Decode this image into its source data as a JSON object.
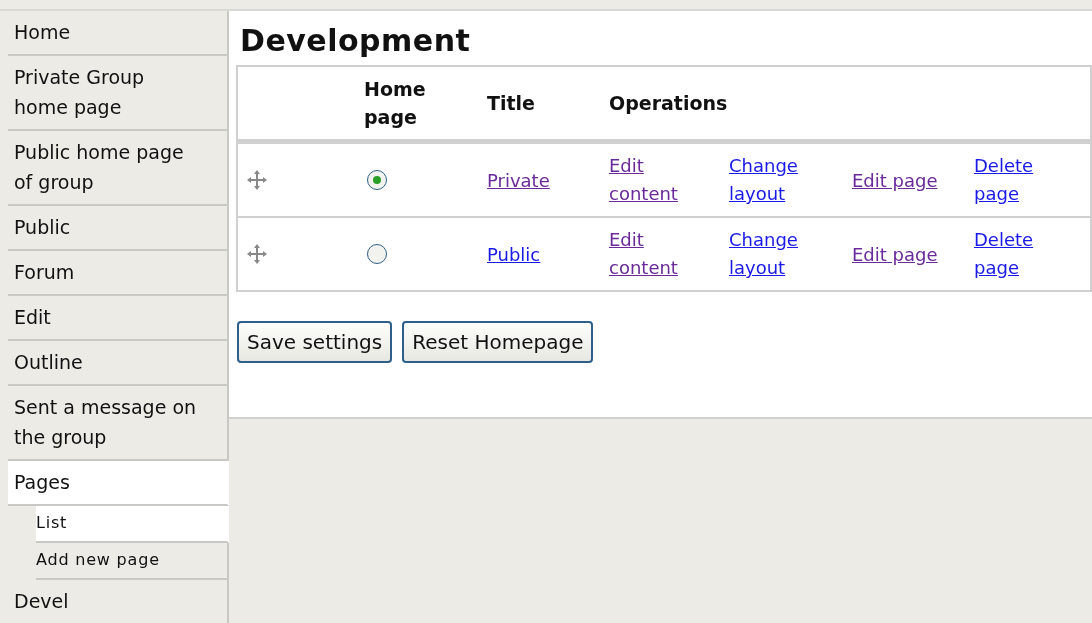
{
  "sidebar": {
    "items": [
      {
        "label": "Home",
        "selected": false
      },
      {
        "label": "Private Group home page",
        "selected": false
      },
      {
        "label": "Public home page of group",
        "selected": false
      },
      {
        "label": "Public",
        "selected": false
      },
      {
        "label": "Forum",
        "selected": false
      },
      {
        "label": "Edit",
        "selected": false
      },
      {
        "label": "Outline",
        "selected": false
      },
      {
        "label": "Sent a message on the group",
        "selected": false
      },
      {
        "label": "Pages",
        "selected": true,
        "children": [
          {
            "label": "List",
            "selected": true
          },
          {
            "label": "Add new page",
            "selected": false
          }
        ]
      },
      {
        "label": "Devel",
        "selected": false
      }
    ]
  },
  "page_title": "Development",
  "table": {
    "columns": [
      "",
      "Home page",
      "Title",
      "Operations"
    ],
    "rows": [
      {
        "home_page": true,
        "title": {
          "label": "Private",
          "visited": true
        },
        "operations": [
          {
            "label": "Edit content",
            "visited": true
          },
          {
            "label": "Change layout",
            "visited": false
          },
          {
            "label": "Edit page",
            "visited": true
          },
          {
            "label": "Delete page",
            "visited": false
          }
        ]
      },
      {
        "home_page": false,
        "title": {
          "label": "Public",
          "visited": false
        },
        "operations": [
          {
            "label": "Edit content",
            "visited": true
          },
          {
            "label": "Change layout",
            "visited": false
          },
          {
            "label": "Edit page",
            "visited": true
          },
          {
            "label": "Delete page",
            "visited": false
          }
        ]
      }
    ]
  },
  "buttons": [
    "Save settings",
    "Reset Homepage"
  ]
}
